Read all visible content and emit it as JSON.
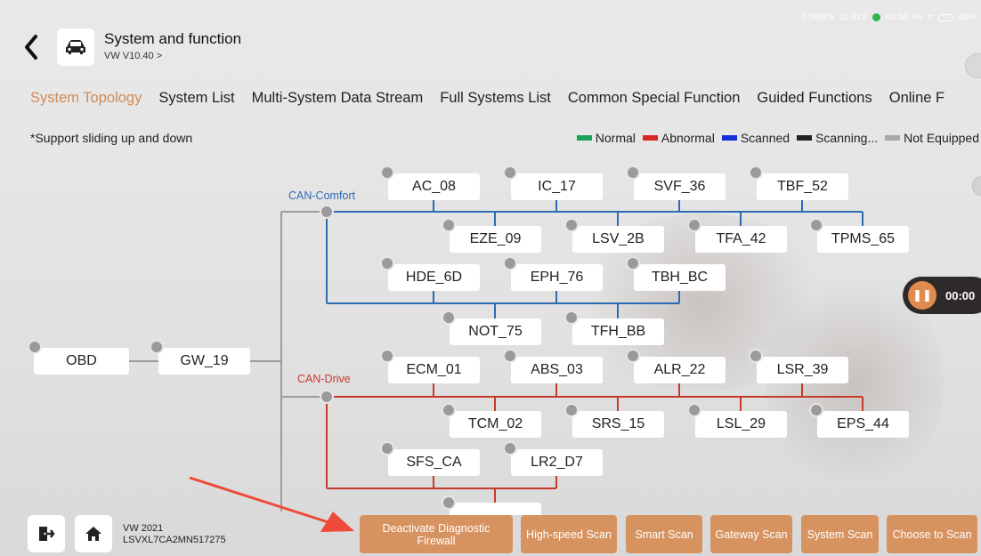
{
  "status_bar": {
    "speed": "0.0KB/S",
    "voltage": "11.81V",
    "time": "04:58",
    "ampm": "PM",
    "battery": "48%"
  },
  "header": {
    "title": "System and function",
    "subtitle": "VW V10.40 >"
  },
  "tabs": [
    {
      "label": "System Topology",
      "active": true
    },
    {
      "label": "System List"
    },
    {
      "label": "Multi-System Data Stream"
    },
    {
      "label": "Full Systems List"
    },
    {
      "label": "Common Special Function"
    },
    {
      "label": "Guided Functions"
    },
    {
      "label": "Online F"
    }
  ],
  "hint": "*Support sliding up and down",
  "legend": [
    {
      "label": "Normal",
      "color": "#1aa35a"
    },
    {
      "label": "Abnormal",
      "color": "#d8281f"
    },
    {
      "label": "Scanned",
      "color": "#1530d8"
    },
    {
      "label": "Scanning...",
      "color": "#222222"
    },
    {
      "label": "Not Equipped",
      "color": "#a8a8a8"
    }
  ],
  "topology": {
    "root": "OBD",
    "gateway": "GW_19",
    "bus_comfort": "CAN-Comfort",
    "bus_drive": "CAN-Drive",
    "comfort_row1": [
      "AC_08",
      "IC_17",
      "SVF_36",
      "TBF_52"
    ],
    "comfort_row2": [
      "EZE_09",
      "LSV_2B",
      "TFA_42",
      "TPMS_65"
    ],
    "comfort_row3": [
      "HDE_6D",
      "EPH_76",
      "TBH_BC"
    ],
    "comfort_row4": [
      "NOT_75",
      "TFH_BB"
    ],
    "drive_row1": [
      "ECM_01",
      "ABS_03",
      "ALR_22",
      "LSR_39"
    ],
    "drive_row2": [
      "TCM_02",
      "SRS_15",
      "LSL_29",
      "EPS_44"
    ],
    "drive_row3": [
      "SFS_CA",
      "LR2_D7"
    ]
  },
  "timer": {
    "time": "00:00"
  },
  "vehicle": {
    "model": "VW  2021",
    "vin": "LSVXL7CA2MN517275"
  },
  "actions": [
    "Deactivate Diagnostic Firewall",
    "High-speed Scan",
    "Smart Scan",
    "Gateway Scan",
    "System Scan",
    "Choose to Scan"
  ],
  "colors": {
    "accent": "#d08a55",
    "button": "#d7935f",
    "comfort_bus": "#2d6bb3",
    "drive_bus": "#c63a2c",
    "arrow": "#ef4a3a"
  }
}
